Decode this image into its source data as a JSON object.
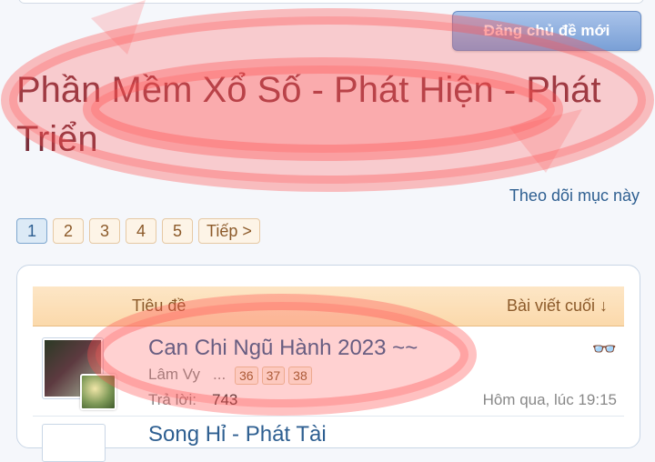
{
  "header": {
    "new_thread_button": "Đăng chủ đề mới"
  },
  "page_title": "Phần Mềm Xổ Số - Phát Hiện - Phát Triển",
  "watch_link": "Theo dõi mục này",
  "pagination": {
    "pages": [
      "1",
      "2",
      "3",
      "4",
      "5"
    ],
    "current": "1",
    "next": "Tiếp >"
  },
  "table": {
    "col_title": "Tiêu đề",
    "col_last": "Bài viết cuối ↓",
    "threads": [
      {
        "title": "Can Chi Ngũ Hành 2023 ~~",
        "author": "Lâm Vy",
        "ellipsis": "...",
        "pages": [
          "36",
          "37",
          "38"
        ],
        "replies_label": "Trả lời:",
        "replies": "743",
        "last_post": "Hôm qua, lúc 19:15",
        "icon": "glasses-icon"
      },
      {
        "title": "Song Hỉ - Phát Tài"
      }
    ]
  },
  "colors": {
    "accent": "#2e5f91",
    "title": "#7a2e3a",
    "table_header": "#fbd9ab",
    "annotation": "#ff5a5a"
  }
}
